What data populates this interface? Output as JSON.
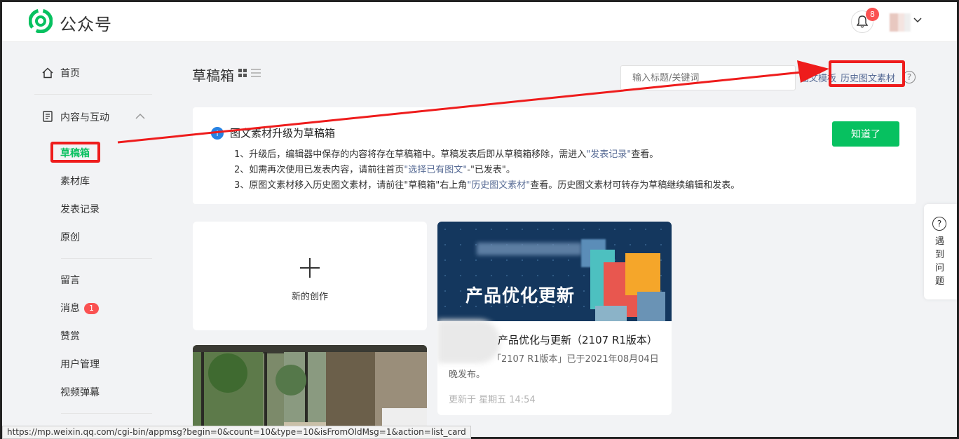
{
  "header": {
    "brand": "公众号",
    "notification_count": "8",
    "icons": [
      "logo-icon",
      "bell-icon",
      "chevron-down-icon"
    ]
  },
  "sidebar": {
    "home": "首页",
    "content_group": "内容与互动",
    "items": [
      "草稿箱",
      "素材库",
      "发表记录",
      "原创"
    ],
    "items2": [
      "留言",
      "消息",
      "赞赏",
      "用户管理",
      "视频弹幕"
    ],
    "message_badge": "1",
    "active": "草稿箱"
  },
  "main": {
    "title": "草稿箱",
    "search_placeholder": "输入标题/关键词",
    "link_template": "图文模板",
    "link_history": "历史图文素材",
    "help_mark": "?"
  },
  "notice": {
    "title": "图文素材升级为草稿箱",
    "line1_a": "1、升级后，编辑器中保存的内容将存在草稿箱中。草稿发表后即从草稿箱移除，需进入",
    "line1_link": "\"发表记录\"",
    "line1_b": "查看。",
    "line2_a": "2、如需再次使用已发表内容，请前往首页",
    "line2_link": "\"选择已有图文\"",
    "line2_b": "-\"已发表\"。",
    "line3_a": "3、原图文素材移入历史图文素材，请前往\"草稿箱\"右上角",
    "line3_link": "\"历史图文素材\"",
    "line3_b": "查看。历史图文素材可转存为草稿继续编辑和发表。",
    "button": "知道了"
  },
  "cards": {
    "new_label": "新的创作",
    "article": {
      "cover_text": "产品优化更新",
      "title": "产品优化与更新（2107 R1版本）",
      "desc": "「2107 R1版本」已于2021年08月04日晚发布。",
      "desc_line1": "「2107 R1版本」已于2021年08月04日",
      "desc_line2": "晚发布。",
      "time": "更新于 星期五 14:54"
    }
  },
  "help_side": {
    "text": "遇到问题"
  },
  "status_url": "https://mp.weixin.qq.com/cgi-bin/appmsg?begin=0&count=10&type=10&isFromOldMsg=1&action=list_card",
  "colors": {
    "accent": "#07c160",
    "link": "#576b95",
    "badge": "#fa5151",
    "annotation": "#ee1c1c"
  }
}
